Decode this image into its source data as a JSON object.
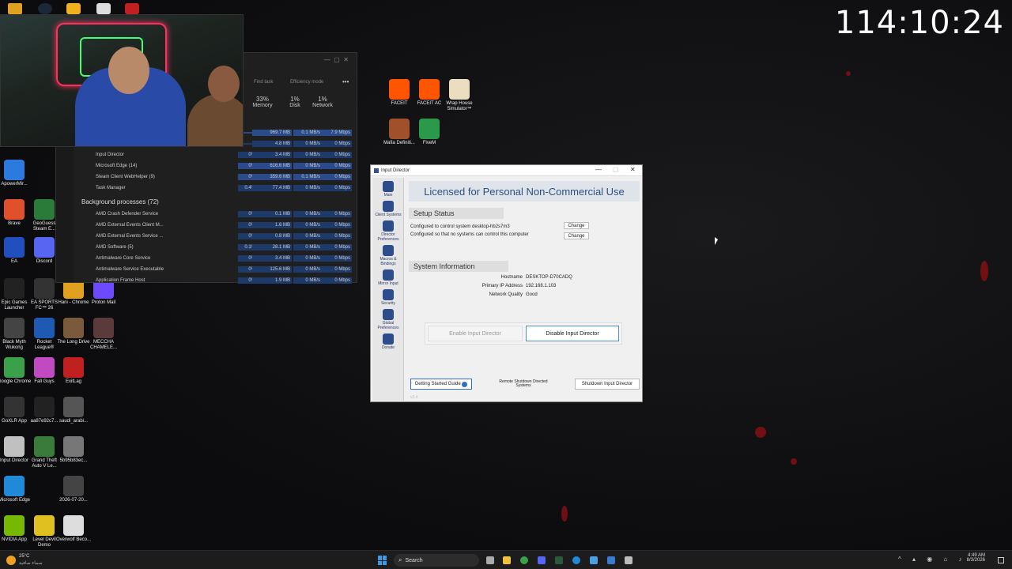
{
  "timer": "114:10:24",
  "desktop_icons": [
    {
      "label": "ApowerMir...",
      "color": "#2a7ae0"
    },
    {
      "label": "Brave",
      "color": "#e0502a"
    },
    {
      "label": "GeoGuess Steam E...",
      "color": "#2a7a3a"
    },
    {
      "label": "EA",
      "color": "#2050c0"
    },
    {
      "label": "Discord",
      "color": "#5865f2"
    },
    {
      "label": "Epic Games Launcher",
      "color": "#222"
    },
    {
      "label": "EA SPORTS FC™ 26",
      "color": "#333"
    },
    {
      "label": "Hani - Chrome",
      "color": "#e0a020"
    },
    {
      "label": "Proton Mail",
      "color": "#6d4aff"
    },
    {
      "label": "Black Myth Wukong",
      "color": "#444"
    },
    {
      "label": "Rocket League®",
      "color": "#1e5ab4"
    },
    {
      "label": "The Long Drive",
      "color": "#7a5a3a"
    },
    {
      "label": "MECCHA CHAMELE...",
      "color": "#5a3a3a"
    },
    {
      "label": "Google Chrome",
      "color": "#3aa04a"
    },
    {
      "label": "Fall Guys",
      "color": "#c04ac0"
    },
    {
      "label": "ExitLag",
      "color": "#c02020"
    },
    {
      "label": "GoXLR App",
      "color": "#333"
    },
    {
      "label": "aa87e92c7...",
      "color": "#222"
    },
    {
      "label": "saudi_arabi...",
      "color": "#555"
    },
    {
      "label": "Input Director",
      "color": "#c0c0c0"
    },
    {
      "label": "Grand Theft Auto V Le...",
      "color": "#3a7a3a"
    },
    {
      "label": "5b95b83ec...",
      "color": "#777"
    },
    {
      "label": "Microsoft Edge",
      "color": "#1e8ad8"
    },
    {
      "label": "2026-07-20...",
      "color": "#444"
    },
    {
      "label": "NVIDIA App",
      "color": "#76b900"
    },
    {
      "label": "Level Devil Demo",
      "color": "#e0c020"
    },
    {
      "label": "Overwolf Beco...",
      "color": "#ddd"
    },
    {
      "label": "FACEIT",
      "color": "#ff5500"
    },
    {
      "label": "FACEIT AC",
      "color": "#ff5500"
    },
    {
      "label": "Wrap House Simulator™",
      "color": "#eaddc0"
    },
    {
      "label": "Mafia Definiti...",
      "color": "#a0502a"
    },
    {
      "label": "FiveM",
      "color": "#2a9a4a"
    }
  ],
  "taskmanager": {
    "actions": [
      "Find task",
      "Efficiency mode",
      "•••"
    ],
    "col_headers": [
      {
        "pct": "33%",
        "name": "Memory"
      },
      {
        "pct": "1%",
        "name": "Disk"
      },
      {
        "pct": "1%",
        "name": "Network"
      }
    ],
    "apps": [
      {
        "name": "",
        "cpu": "",
        "mem": "969.7 MB",
        "disk": "0.1 MB/s",
        "net": "7.9 Mbps"
      },
      {
        "name": "",
        "cpu": "",
        "mem": "4.8 MB",
        "disk": "0 MB/s",
        "net": "0 Mbps"
      },
      {
        "name": "Input Director",
        "cpu": "0%",
        "mem": "3.4 MB",
        "disk": "0 MB/s",
        "net": "0 Mbps"
      },
      {
        "name": "Microsoft Edge (14)",
        "cpu": "0%",
        "mem": "616.6 MB",
        "disk": "0 MB/s",
        "net": "0 Mbps"
      },
      {
        "name": "Steam Client WebHelper (9)",
        "cpu": "0%",
        "mem": "359.6 MB",
        "disk": "0.1 MB/s",
        "net": "0 Mbps"
      },
      {
        "name": "Task Manager",
        "cpu": "0.4%",
        "mem": "77.4 MB",
        "disk": "0 MB/s",
        "net": "0 Mbps"
      }
    ],
    "bg_header": "Background processes (72)",
    "bg": [
      {
        "name": "AMD Crash Defender Service",
        "cpu": "0%",
        "mem": "0.1 MB",
        "disk": "0 MB/s",
        "net": "0 Mbps"
      },
      {
        "name": "AMD External Events Client M...",
        "cpu": "0%",
        "mem": "1.6 MB",
        "disk": "0 MB/s",
        "net": "0 Mbps"
      },
      {
        "name": "AMD External Events Service ...",
        "cpu": "0%",
        "mem": "0.8 MB",
        "disk": "0 MB/s",
        "net": "0 Mbps"
      },
      {
        "name": "AMD Software (5)",
        "cpu": "0.1%",
        "mem": "28.1 MB",
        "disk": "0 MB/s",
        "net": "0 Mbps"
      },
      {
        "name": "Antimalware Core Service",
        "cpu": "0%",
        "mem": "3.4 MB",
        "disk": "0 MB/s",
        "net": "0 Mbps"
      },
      {
        "name": "Antimalware Service Executable",
        "cpu": "0%",
        "mem": "125.6 MB",
        "disk": "0 MB/s",
        "net": "0 Mbps"
      },
      {
        "name": "Application Frame Host",
        "cpu": "0%",
        "mem": "1.9 MB",
        "disk": "0 MB/s",
        "net": "0 Mbps"
      }
    ]
  },
  "inputdirector": {
    "title": "Input Director",
    "banner": "Licensed for Personal Non-Commercial Use",
    "nav": [
      "Main",
      "Client Systems",
      "Director Preferences",
      "Macros & Bindings",
      "Mirror Input",
      "Security",
      "Global Preferences",
      "Donate"
    ],
    "setup_title": "Setup Status",
    "setup_line1": "Configured to control system desktop-hb2s7m3",
    "setup_line2": "Configured so that no systems can control this computer",
    "change": "Change",
    "sysinfo_title": "System Information",
    "hostname_label": "Hostname",
    "hostname": "DESKTOP-D70CADQ",
    "ip_label": "Primary IP Address",
    "ip": "192.168.1.103",
    "quality_label": "Network Quality",
    "quality": "Good",
    "enable_btn": "Enable Input Director",
    "disable_btn": "Disable Input Director",
    "guide_btn": "Getting Started Guide",
    "remote_btn": "Remote Shutdown Directed Systems",
    "shutdown_btn": "Shutdown Input Director",
    "version": "v2.4"
  },
  "taskbar": {
    "weather_temp": "25°C",
    "weather_desc": "سماء صافية",
    "search": "Search",
    "time": "4:49 AM",
    "date": "8/3/2026"
  }
}
